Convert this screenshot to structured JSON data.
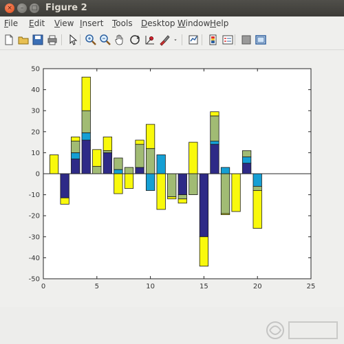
{
  "window": {
    "title": "Figure 2",
    "buttons": {
      "close": "×",
      "minimize": "–",
      "maximize": "□"
    }
  },
  "menu": [
    {
      "label": "File",
      "ul": "F",
      "rest": "ile"
    },
    {
      "label": "Edit",
      "ul": "E",
      "rest": "dit"
    },
    {
      "label": "View",
      "ul": "V",
      "rest": "iew"
    },
    {
      "label": "Insert",
      "ul": "I",
      "rest": "nsert"
    },
    {
      "label": "Tools",
      "ul": "T",
      "rest": "ools"
    },
    {
      "label": "Desktop",
      "ul": "D",
      "rest": "esktop"
    },
    {
      "label": "Window",
      "ul": "W",
      "rest": "indow"
    },
    {
      "label": "Help",
      "ul": "H",
      "rest": "elp"
    }
  ],
  "toolbar": [
    "new-figure-icon",
    "open-file-icon",
    "save-icon",
    "print-icon",
    "pointer-icon",
    "zoom-in-icon",
    "zoom-out-icon",
    "pan-icon",
    "rotate-icon",
    "data-cursor-icon",
    "brush-icon",
    "brush-dropdown-icon",
    "link-plot-icon",
    "colorbar-icon",
    "legend-icon",
    "hide-plot-tools-icon",
    "show-plot-tools-icon"
  ],
  "colors": {
    "series": [
      "#2e2a87",
      "#159fd4",
      "#a1bb74",
      "#f9f90c"
    ],
    "axes_bg": "#ffffff",
    "figure_bg": "#efefed"
  },
  "chart_data": {
    "type": "bar",
    "stacked": true,
    "title": "",
    "xlabel": "",
    "ylabel": "",
    "xlim": [
      0,
      25
    ],
    "ylim": [
      -50,
      50
    ],
    "xticks": [
      0,
      5,
      10,
      15,
      20,
      25
    ],
    "yticks": [
      -50,
      -40,
      -30,
      -20,
      -10,
      0,
      10,
      20,
      30,
      40,
      50
    ],
    "grid": false,
    "x": [
      1,
      2,
      3,
      4,
      5,
      6,
      7,
      8,
      9,
      10,
      11,
      12,
      13,
      14,
      15,
      16,
      17,
      18,
      19,
      20
    ],
    "series": [
      {
        "values": [
          0,
          -11.5,
          7,
          16,
          0,
          10,
          0,
          0,
          3,
          0,
          0,
          0,
          -10,
          0,
          -30,
          14,
          0,
          0,
          5,
          0
        ]
      },
      {
        "values": [
          0,
          0,
          3,
          3.5,
          0,
          0,
          2,
          0,
          0,
          -8,
          9,
          0,
          0,
          0,
          0,
          1.5,
          3,
          0,
          3,
          -6
        ]
      },
      {
        "values": [
          0,
          0,
          5.5,
          10.5,
          3.5,
          1,
          5.5,
          3,
          11,
          12,
          0,
          -11,
          -2,
          -10,
          0,
          12,
          -19,
          0,
          3,
          -2
        ]
      },
      {
        "values": [
          9,
          -3,
          2,
          16,
          8,
          6.5,
          -9.5,
          -7,
          2,
          11.5,
          -17,
          -1,
          -2,
          15,
          -14,
          2,
          -0.5,
          -18,
          0,
          -18
        ]
      }
    ]
  }
}
